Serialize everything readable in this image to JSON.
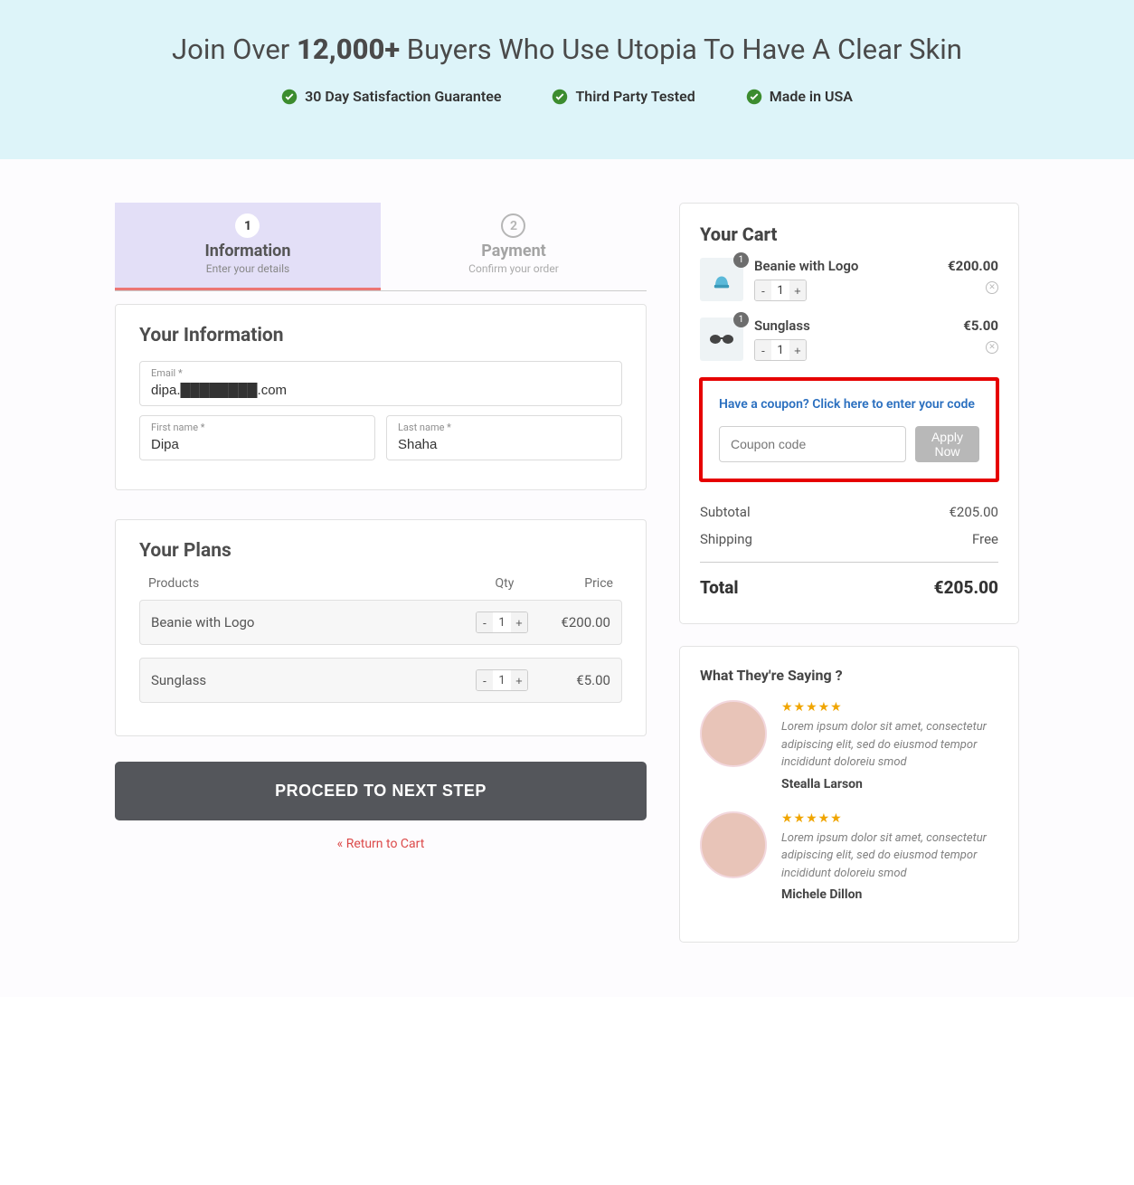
{
  "hero": {
    "headline_pre": "Join Over ",
    "headline_bold": "12,000+",
    "headline_post": " Buyers Who Use Utopia To Have A Clear Skin",
    "badges": [
      "30 Day Satisfaction Guarantee",
      "Third Party Tested",
      "Made in USA"
    ]
  },
  "steps": [
    {
      "num": "1",
      "title": "Information",
      "sub": "Enter your details"
    },
    {
      "num": "2",
      "title": "Payment",
      "sub": "Confirm your order"
    }
  ],
  "info": {
    "heading": "Your Information",
    "email_label": "Email *",
    "email_value": "dipa.████████.com",
    "first_label": "First name *",
    "first_value": "Dipa",
    "last_label": "Last name *",
    "last_value": "Shaha"
  },
  "plans": {
    "heading": "Your Plans",
    "col_product": "Products",
    "col_qty": "Qty",
    "col_price": "Price",
    "rows": [
      {
        "name": "Beanie with Logo",
        "qty": "1",
        "price": "€200.00"
      },
      {
        "name": "Sunglass",
        "qty": "1",
        "price": "€5.00"
      }
    ]
  },
  "actions": {
    "proceed": "PROCEED TO NEXT STEP",
    "return": "« Return to Cart"
  },
  "cart": {
    "heading": "Your Cart",
    "items": [
      {
        "name": "Beanie with Logo",
        "price": "€200.00",
        "qty": "1",
        "badge": "1"
      },
      {
        "name": "Sunglass",
        "price": "€5.00",
        "qty": "1",
        "badge": "1"
      }
    ],
    "coupon_link": "Have a coupon? Click here to enter your code",
    "coupon_placeholder": "Coupon code",
    "apply_label": "Apply Now",
    "subtotal_label": "Subtotal",
    "subtotal_value": "€205.00",
    "shipping_label": "Shipping",
    "shipping_value": "Free",
    "total_label": "Total",
    "total_value": "€205.00"
  },
  "reviews": {
    "heading": "What They're Saying ?",
    "items": [
      {
        "stars": "★★★★★",
        "text": "Lorem ipsum dolor sit amet, consectetur adipiscing elit, sed do eiusmod tempor incididunt doloreiu smod",
        "name": "Stealla Larson"
      },
      {
        "stars": "★★★★★",
        "text": "Lorem ipsum dolor sit amet, consectetur adipiscing elit, sed do eiusmod tempor incididunt doloreiu smod",
        "name": "Michele Dillon"
      }
    ]
  }
}
